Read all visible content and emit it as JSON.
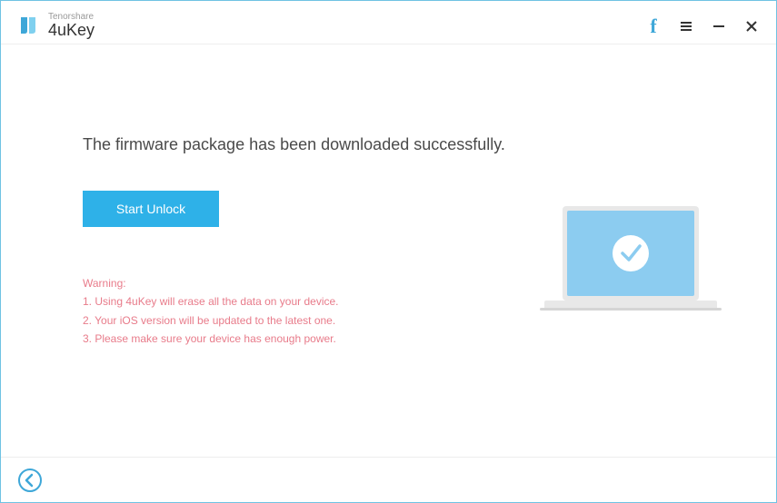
{
  "brand": {
    "company": "Tenorshare",
    "product": "4uKey"
  },
  "titleControls": {
    "facebook_icon": "facebook-icon",
    "menu_icon": "menu-icon",
    "minimize_icon": "minimize-icon",
    "close_icon": "close-icon"
  },
  "main": {
    "headline": "The firmware package has been downloaded successfully.",
    "action_label": "Start Unlock"
  },
  "warning": {
    "title": "Warning:",
    "items": [
      "1. Using 4uKey will erase all the data on your device.",
      "2. Your iOS version will be updated to the latest one.",
      "3. Please make sure your device has enough power."
    ]
  },
  "illustration": {
    "name": "laptop-success-icon"
  },
  "footer": {
    "back_name": "back-icon"
  },
  "colors": {
    "accent": "#2eb1e8",
    "warning_text": "#e87b8a"
  }
}
